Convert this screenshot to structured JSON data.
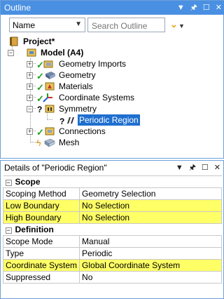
{
  "outline": {
    "title": "Outline",
    "filter_select": "Name",
    "search_placeholder": "Search Outline",
    "tree": {
      "project": "Project*",
      "model": "Model (A4)",
      "items": {
        "geometry_imports": "Geometry Imports",
        "geometry": "Geometry",
        "materials": "Materials",
        "coordinate_systems": "Coordinate Systems",
        "symmetry": "Symmetry",
        "periodic_region": "Periodic Region",
        "connections": "Connections",
        "mesh": "Mesh"
      }
    },
    "controls": {
      "dropdown": "▼",
      "pin": "📌",
      "maximize": "☐",
      "close": "✕"
    }
  },
  "details": {
    "title": "Details of \"Periodic Region\"",
    "groups": [
      {
        "name": "Scope",
        "rows": [
          {
            "label": "Scoping Method",
            "value": "Geometry Selection",
            "highlight": false
          },
          {
            "label": "Low Boundary",
            "value": "No Selection",
            "highlight": true
          },
          {
            "label": "High Boundary",
            "value": "No Selection",
            "highlight": true
          }
        ]
      },
      {
        "name": "Definition",
        "rows": [
          {
            "label": "Scope Mode",
            "value": "Manual",
            "highlight": false
          },
          {
            "label": "Type",
            "value": "Periodic",
            "highlight": false
          },
          {
            "label": "Coordinate System",
            "value": "Global Coordinate System",
            "highlight": true
          },
          {
            "label": "Suppressed",
            "value": "No",
            "highlight": false
          }
        ]
      }
    ],
    "controls": {
      "dropdown": "▼",
      "pin": "📌",
      "maximize": "☐",
      "close": "✕"
    }
  },
  "colors": {
    "title_bar": "#4a90e2",
    "highlight": "#ffff66",
    "selection": "#1f6fcf",
    "check": "#21a121"
  }
}
